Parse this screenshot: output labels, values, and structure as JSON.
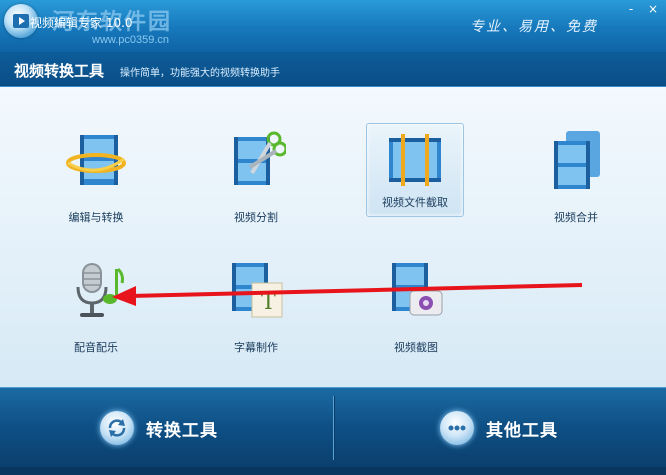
{
  "window": {
    "title": "视频编辑专家 10.0",
    "watermark": "河东软件园",
    "watermark_url": "www.pc0359.cn",
    "slogan": "专业、易用、免费",
    "minimize": "-",
    "close": "×"
  },
  "header": {
    "title": "视频转换工具",
    "description": "操作简单，功能强大的视频转换助手"
  },
  "tools": [
    {
      "label": "编辑与转换",
      "icon": "film-globe-icon"
    },
    {
      "label": "视频分割",
      "icon": "film-scissors-icon"
    },
    {
      "label": "视频文件截取",
      "icon": "film-crop-icon"
    },
    {
      "label": "视频合并",
      "icon": "film-merge-icon"
    },
    {
      "label": "配音配乐",
      "icon": "microphone-music-icon"
    },
    {
      "label": "字幕制作",
      "icon": "film-text-icon"
    },
    {
      "label": "视频截图",
      "icon": "film-camera-icon"
    }
  ],
  "bottom": {
    "convert_label": "转换工具",
    "other_label": "其他工具"
  },
  "colors": {
    "accent": "#1678bb",
    "annotation_arrow": "#e8141b"
  }
}
